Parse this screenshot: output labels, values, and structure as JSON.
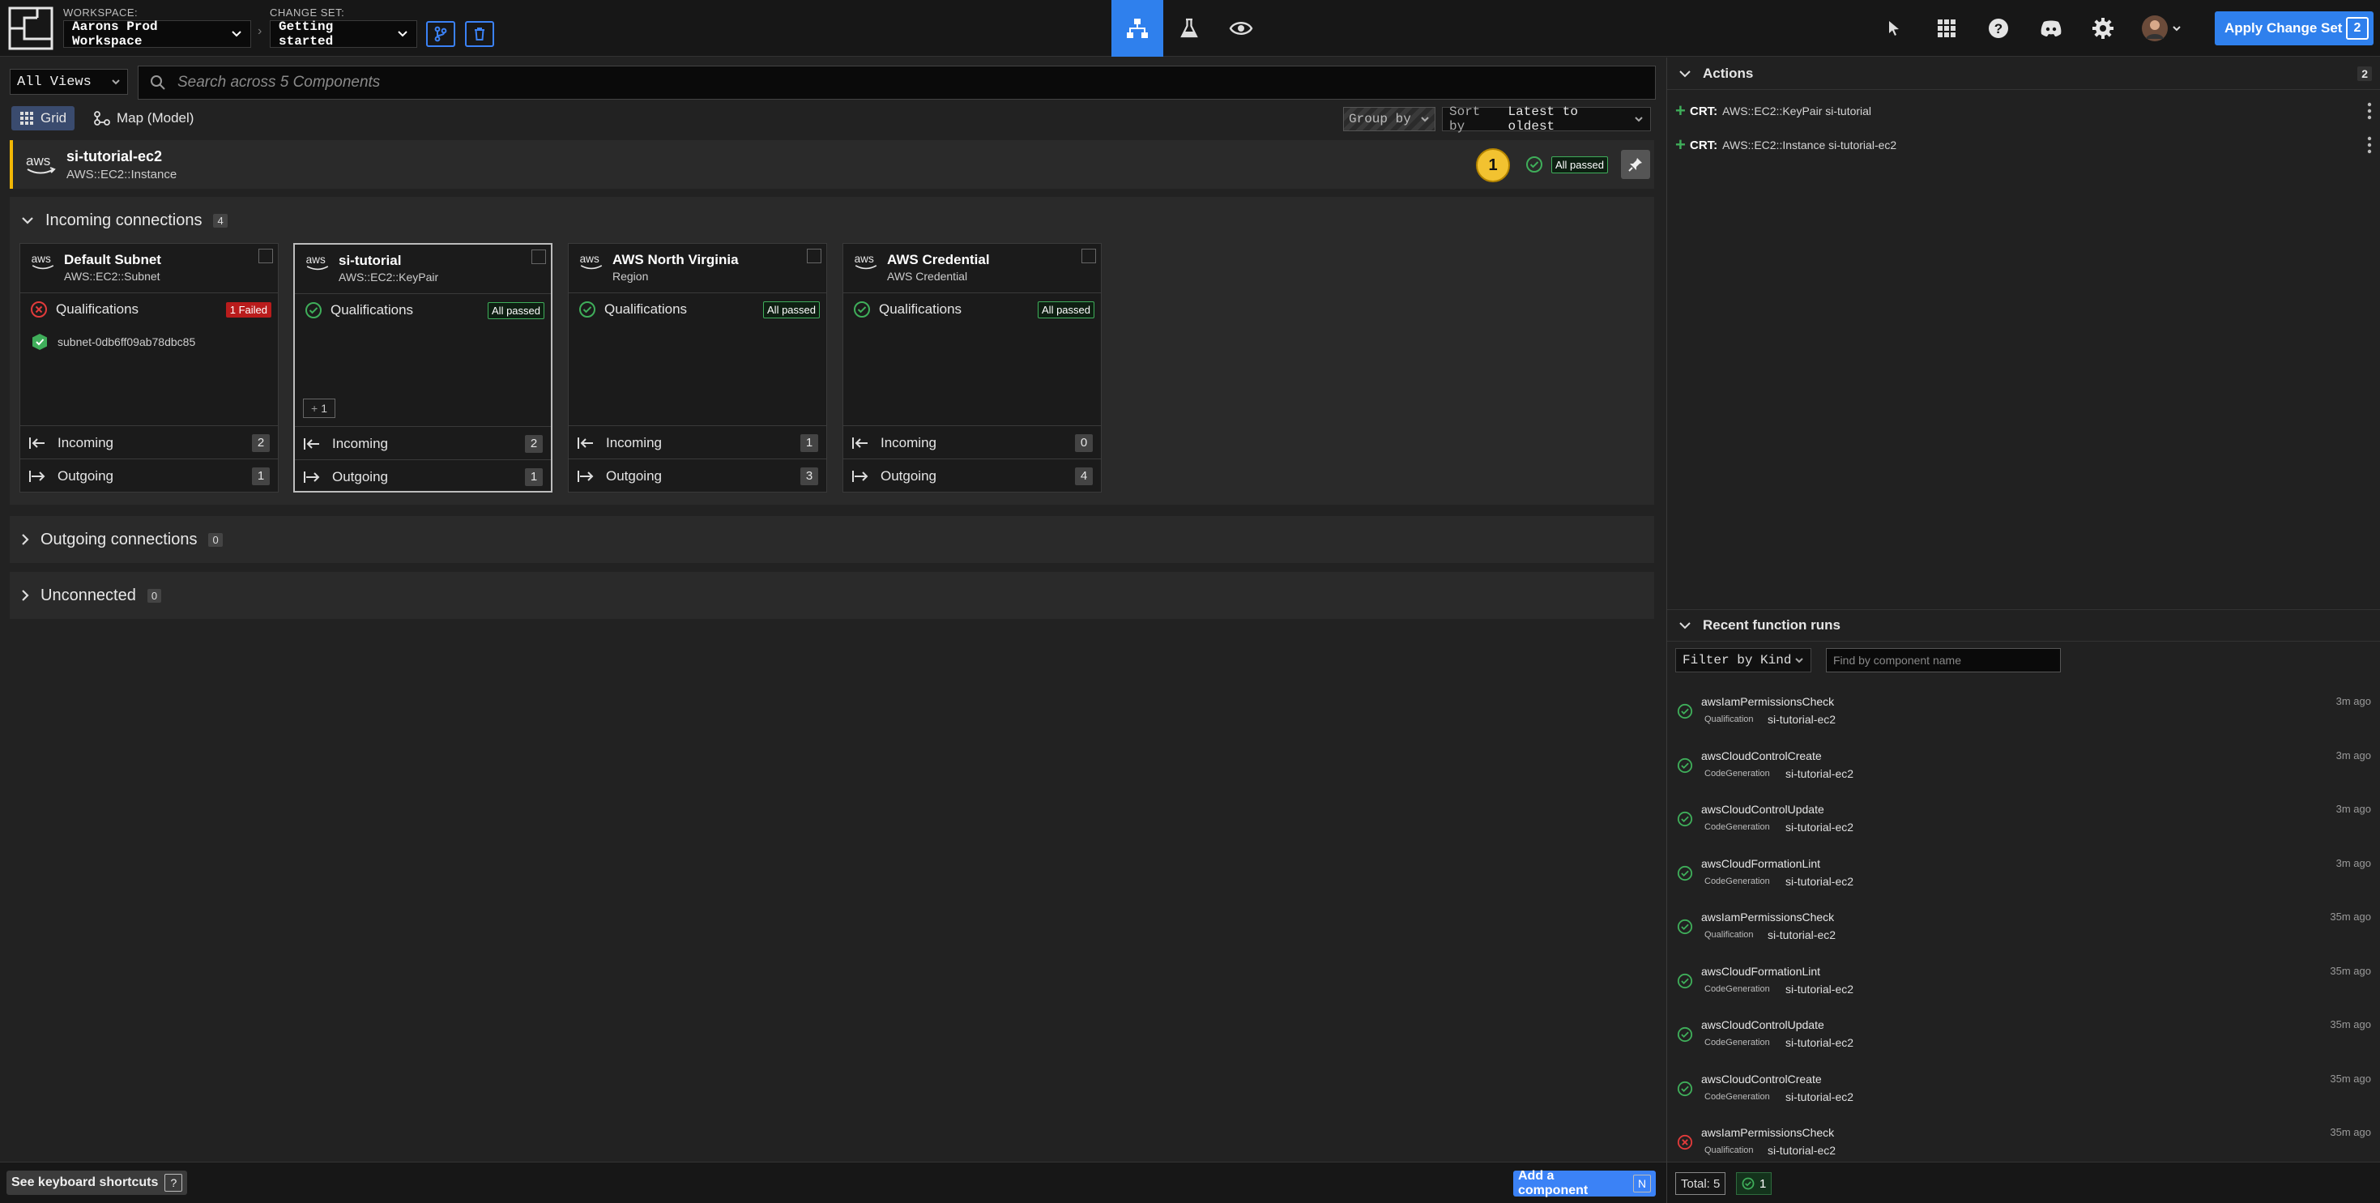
{
  "topbar": {
    "workspace_label": "WORKSPACE:",
    "workspace_value": "Aarons Prod Workspace",
    "changeset_label": "CHANGE SET:",
    "changeset_value": "Getting started",
    "apply_label": "Apply Change Set",
    "apply_count": "2"
  },
  "toolbar": {
    "views_value": "All Views",
    "search_placeholder": "Search across 5 Components",
    "grid_label": "Grid",
    "map_label": "Map (Model)",
    "group_by_label": "Group by",
    "sort_by_prefix": "Sort by",
    "sort_by_value": "Latest to oldest"
  },
  "selected_component": {
    "name": "si-tutorial-ec2",
    "type": "AWS::EC2::Instance",
    "badge": "1",
    "status": "All passed"
  },
  "incoming": {
    "title": "Incoming connections",
    "count": "4",
    "cards": [
      {
        "name": "Default Subnet",
        "type": "AWS::EC2::Subnet",
        "qual_label": "Qualifications",
        "qual_status": "1 Failed",
        "resource": "subnet-0db6ff09ab78dbc85",
        "incoming_label": "Incoming",
        "incoming": "2",
        "outgoing_label": "Outgoing",
        "outgoing": "1"
      },
      {
        "name": "si-tutorial",
        "type": "AWS::EC2::KeyPair",
        "qual_label": "Qualifications",
        "qual_status": "All passed",
        "plus": "1",
        "incoming_label": "Incoming",
        "incoming": "2",
        "outgoing_label": "Outgoing",
        "outgoing": "1"
      },
      {
        "name": "AWS North Virginia",
        "type": "Region",
        "qual_label": "Qualifications",
        "qual_status": "All passed",
        "incoming_label": "Incoming",
        "incoming": "1",
        "outgoing_label": "Outgoing",
        "outgoing": "3"
      },
      {
        "name": "AWS Credential",
        "type": "AWS Credential",
        "qual_label": "Qualifications",
        "qual_status": "All passed",
        "incoming_label": "Incoming",
        "incoming": "0",
        "outgoing_label": "Outgoing",
        "outgoing": "4"
      }
    ]
  },
  "outgoing": {
    "title": "Outgoing connections",
    "count": "0"
  },
  "unconnected": {
    "title": "Unconnected",
    "count": "0"
  },
  "bottom": {
    "shortcuts_label": "See keyboard shortcuts",
    "shortcuts_key": "?",
    "add_label": "Add a component",
    "add_key": "N"
  },
  "actions": {
    "title": "Actions",
    "count": "2",
    "items": [
      {
        "kind": "CRT:",
        "text": "AWS::EC2::KeyPair si-tutorial"
      },
      {
        "kind": "CRT:",
        "text": "AWS::EC2::Instance si-tutorial-ec2"
      }
    ]
  },
  "runs": {
    "title": "Recent function runs",
    "filter_label": "Filter by Kind",
    "find_placeholder": "Find by component name",
    "items": [
      {
        "name": "awsIamPermissionsCheck",
        "kind": "Qualification",
        "component": "si-tutorial-ec2",
        "ago": "3m ago",
        "ok": true
      },
      {
        "name": "awsCloudControlCreate",
        "kind": "CodeGeneration",
        "component": "si-tutorial-ec2",
        "ago": "3m ago",
        "ok": true
      },
      {
        "name": "awsCloudControlUpdate",
        "kind": "CodeGeneration",
        "component": "si-tutorial-ec2",
        "ago": "3m ago",
        "ok": true
      },
      {
        "name": "awsCloudFormationLint",
        "kind": "CodeGeneration",
        "component": "si-tutorial-ec2",
        "ago": "3m ago",
        "ok": true
      },
      {
        "name": "awsIamPermissionsCheck",
        "kind": "Qualification",
        "component": "si-tutorial-ec2",
        "ago": "35m ago",
        "ok": true
      },
      {
        "name": "awsCloudFormationLint",
        "kind": "CodeGeneration",
        "component": "si-tutorial-ec2",
        "ago": "35m ago",
        "ok": true
      },
      {
        "name": "awsCloudControlUpdate",
        "kind": "CodeGeneration",
        "component": "si-tutorial-ec2",
        "ago": "35m ago",
        "ok": true
      },
      {
        "name": "awsCloudControlCreate",
        "kind": "CodeGeneration",
        "component": "si-tutorial-ec2",
        "ago": "35m ago",
        "ok": true
      },
      {
        "name": "awsIamPermissionsCheck",
        "kind": "Qualification",
        "component": "si-tutorial-ec2",
        "ago": "35m ago",
        "ok": false
      }
    ],
    "total_label": "Total: 5",
    "ok_count": "1"
  },
  "colors": {
    "accent": "#2f80ed",
    "success": "#3fae5a",
    "fail": "#b91c1c",
    "warning": "#f2c230"
  }
}
